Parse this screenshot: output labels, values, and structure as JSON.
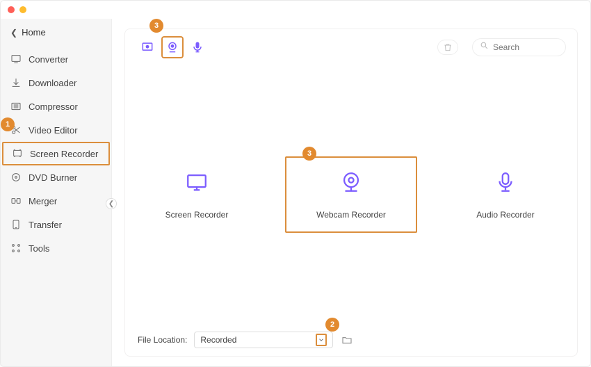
{
  "header": {
    "back_label": "Home"
  },
  "sidebar": {
    "items": [
      {
        "label": "Converter"
      },
      {
        "label": "Downloader"
      },
      {
        "label": "Compressor"
      },
      {
        "label": "Video Editor"
      },
      {
        "label": "Screen Recorder"
      },
      {
        "label": "DVD Burner"
      },
      {
        "label": "Merger"
      },
      {
        "label": "Transfer"
      },
      {
        "label": "Tools"
      }
    ]
  },
  "toolbar": {
    "search_placeholder": "Search"
  },
  "cards": [
    {
      "label": "Screen Recorder"
    },
    {
      "label": "Webcam Recorder"
    },
    {
      "label": "Audio Recorder"
    }
  ],
  "footer": {
    "label": "File Location:",
    "selected": "Recorded"
  },
  "callouts": {
    "c1": "1",
    "c2": "2",
    "c3a": "3",
    "c3b": "3"
  }
}
